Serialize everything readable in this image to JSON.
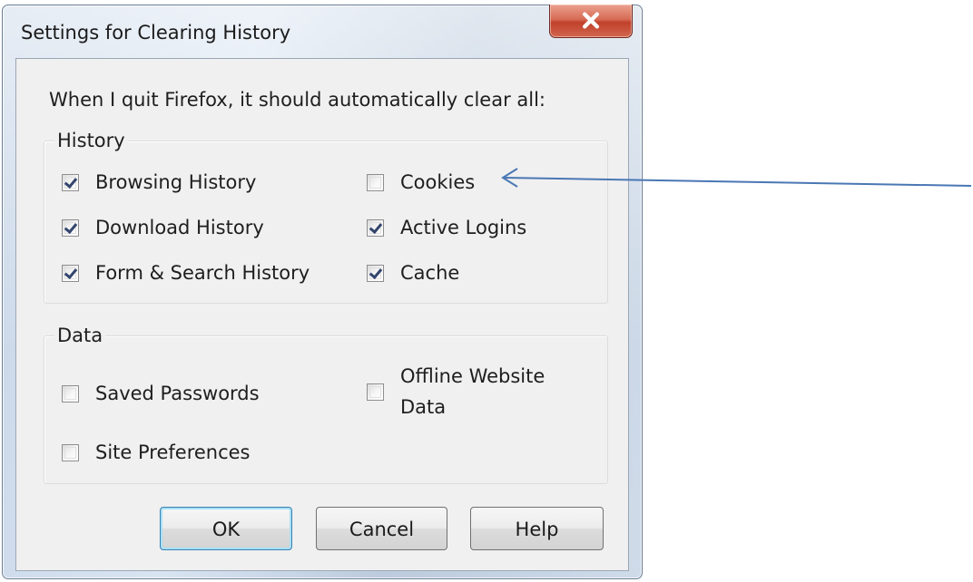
{
  "window": {
    "title": "Settings for Clearing History",
    "close_icon": "close-icon"
  },
  "intro": "When I quit Firefox, it should automatically clear all:",
  "history_group": {
    "label": "History",
    "items": [
      {
        "label": "Browsing History",
        "checked": true
      },
      {
        "label": "Download History",
        "checked": true
      },
      {
        "label": "Form & Search History",
        "checked": true
      },
      {
        "label": "Cookies",
        "checked": false
      },
      {
        "label": "Active Logins",
        "checked": true
      },
      {
        "label": "Cache",
        "checked": true
      }
    ]
  },
  "data_group": {
    "label": "Data",
    "items": [
      {
        "label": "Saved Passwords",
        "checked": false
      },
      {
        "label": "Site Preferences",
        "checked": false
      },
      {
        "label": "Offline Website Data",
        "checked": false
      }
    ]
  },
  "buttons": {
    "ok": "OK",
    "cancel": "Cancel",
    "help": "Help"
  },
  "colors": {
    "close_button": "#c9462f",
    "ok_focus": "#3c7fb1",
    "annotation_arrow": "#4a77b4"
  }
}
